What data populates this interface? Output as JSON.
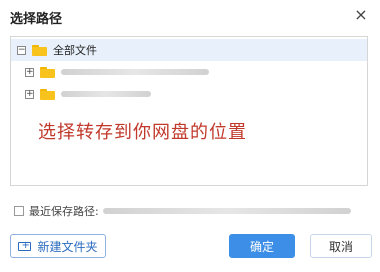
{
  "dialog": {
    "title": "选择路径",
    "close_glyph": "×"
  },
  "tree": {
    "root": {
      "label": "全部文件",
      "toggle": "−"
    },
    "children": [
      {
        "toggle": "+"
      },
      {
        "toggle": "+"
      }
    ]
  },
  "overlay": {
    "text": "选择转存到你网盘的位置"
  },
  "recent": {
    "label": "最近保存路径:"
  },
  "buttons": {
    "new_folder": "新建文件夹",
    "ok": "确定",
    "cancel": "取消"
  },
  "colors": {
    "accent": "#3d8ee6",
    "folder": "#f7c31c",
    "overlay_text": "#c0392b",
    "selected_row": "#e8f1fb"
  }
}
